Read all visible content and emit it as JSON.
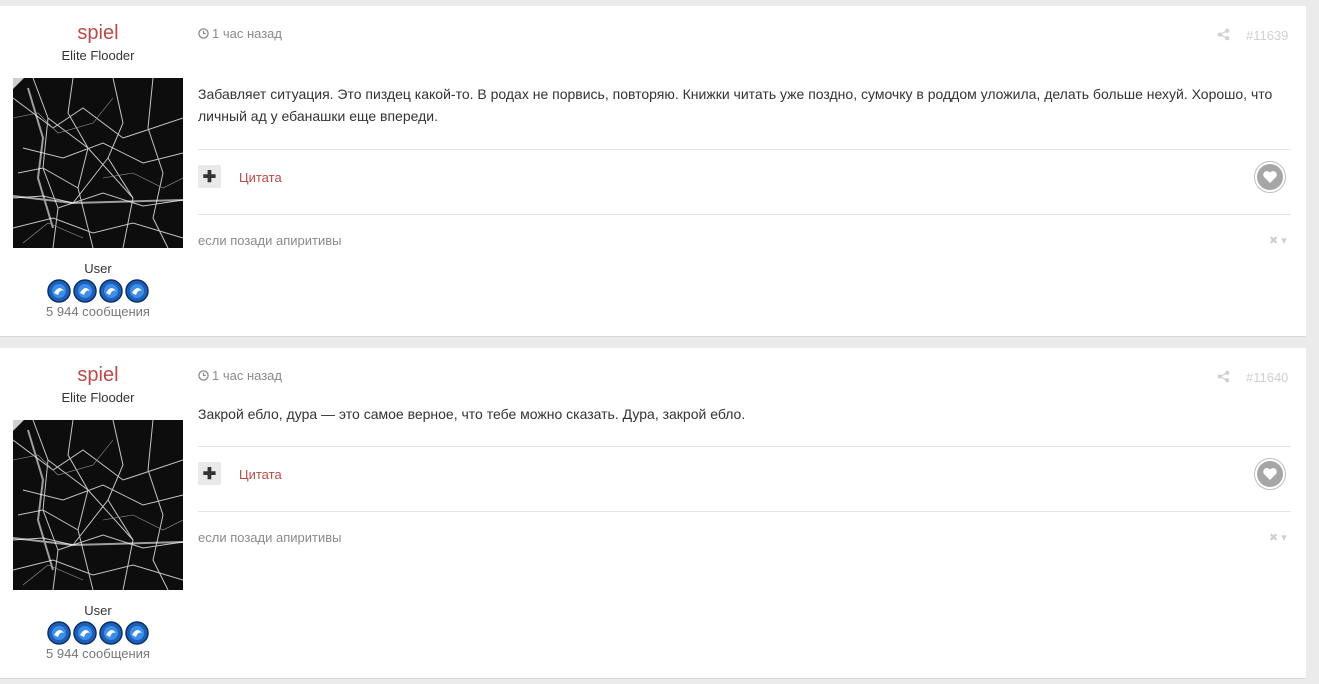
{
  "posts": [
    {
      "author": {
        "name": "spiel",
        "title": "Elite Flooder",
        "group": "User",
        "post_count": "5 944 сообщения",
        "badge_count": 4
      },
      "time": "1 час назад",
      "post_number": "#11639",
      "content": "Забавляет ситуация. Это пиздец какой-то. В родах не порвись, повторяю. Книжки читать уже поздно, сумочку в роддом уложила, делать больше нехуй. Хорошо, что личный ад у ебанашки еще впереди.",
      "plus_label": "✚",
      "quote_label": "Цитата",
      "signature": "если позади апиритивы",
      "signature_controls": "✖ ▾"
    },
    {
      "author": {
        "name": "spiel",
        "title": "Elite Flooder",
        "group": "User",
        "post_count": "5 944 сообщения",
        "badge_count": 4
      },
      "time": "1 час назад",
      "post_number": "#11640",
      "content": "Закрой ебло, дура — это самое верное, что тебе можно сказать. Дура, закрой ебло.",
      "plus_label": "✚",
      "quote_label": "Цитата",
      "signature": "если позади апиритивы",
      "signature_controls": "✖ ▾"
    }
  ],
  "icons": {
    "clock": "clock-icon",
    "share": "share-icon",
    "heart": "heart-icon",
    "badge": "rank-badge-icon"
  },
  "colors": {
    "author_name": "#b94a48",
    "link": "#b94a48",
    "muted": "#8a8a8a",
    "page_bg": "#ebebeb"
  }
}
